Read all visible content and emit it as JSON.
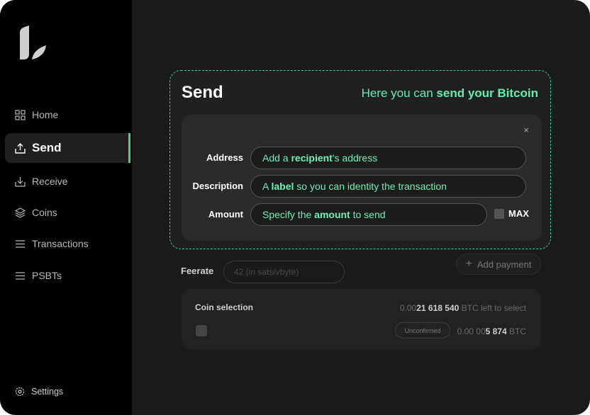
{
  "sidebar": {
    "items": [
      {
        "label": "Home",
        "icon": "grid-icon"
      },
      {
        "label": "Send",
        "icon": "upload-icon"
      },
      {
        "label": "Receive",
        "icon": "download-icon"
      },
      {
        "label": "Coins",
        "icon": "coins-icon"
      },
      {
        "label": "Transactions",
        "icon": "list-icon"
      },
      {
        "label": "PSBTs",
        "icon": "list-icon"
      }
    ],
    "settings_label": "Settings"
  },
  "send": {
    "title": "Send",
    "subtitle_prefix": "Here you can ",
    "subtitle_bold": "send your Bitcoin",
    "close": "×",
    "address": {
      "label": "Address",
      "pre": "Add a ",
      "bold": "recipient",
      "post": "'s address"
    },
    "description": {
      "label": "Description",
      "pre": "A ",
      "bold": "label",
      "post": " so you can identity the transaction"
    },
    "amount": {
      "label": "Amount",
      "pre": "Specify the ",
      "bold": "amount",
      "post": " to send"
    },
    "max_label": "MAX"
  },
  "feerate": {
    "label": "Feerate",
    "placeholder": "42 (in sats/vbyte)"
  },
  "add_payment": {
    "icon": "+",
    "label": "Add payment"
  },
  "coin_selection": {
    "title": "Coin selection",
    "left_prefix": "0.00",
    "left_bold": "21 618 540",
    "left_suffix": " BTC left to select",
    "coin_status": "Unconfirmed",
    "coin_prefix": "0.00 00",
    "coin_bold": "5 874",
    "coin_suffix": " BTC"
  },
  "colors": {
    "accent": "#3ecf8e",
    "accent_text": "#6ef0b5",
    "background": "#1b1b1b",
    "sidebar": "#000000"
  }
}
